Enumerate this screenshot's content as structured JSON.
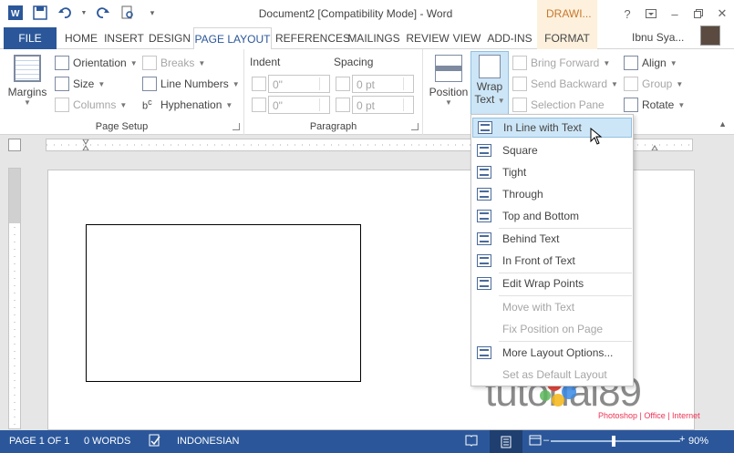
{
  "window": {
    "title": "Document2 [Compatibility Mode] - Word",
    "contextual_tab_group": "DRAWI..."
  },
  "tabs": [
    {
      "label": "FILE"
    },
    {
      "label": "HOME"
    },
    {
      "label": "INSERT"
    },
    {
      "label": "DESIGN"
    },
    {
      "label": "PAGE LAYOUT"
    },
    {
      "label": "REFERENCES"
    },
    {
      "label": "MAILINGS"
    },
    {
      "label": "REVIEW"
    },
    {
      "label": "VIEW"
    },
    {
      "label": "ADD-INS"
    },
    {
      "label": "FORMAT"
    }
  ],
  "user": {
    "name": "Ibnu Sya..."
  },
  "ribbon": {
    "page_setup": {
      "group_label": "Page Setup",
      "margins": "Margins",
      "orientation": "Orientation",
      "size": "Size",
      "columns": "Columns",
      "breaks": "Breaks",
      "line_numbers": "Line Numbers",
      "hyphenation": "Hyphenation"
    },
    "paragraph": {
      "group_label": "Paragraph",
      "indent_label": "Indent",
      "spacing_label": "Spacing",
      "indent_left": "0\"",
      "indent_right": "0\"",
      "spacing_before": "0 pt",
      "spacing_after": "0 pt"
    },
    "arrange": {
      "position": "Position",
      "wrap_text_line1": "Wrap",
      "wrap_text_line2": "Text",
      "bring_forward": "Bring Forward",
      "send_backward": "Send Backward",
      "selection_pane": "Selection Pane",
      "align": "Align",
      "group": "Group",
      "rotate": "Rotate"
    }
  },
  "wrap_menu": {
    "items": [
      {
        "label": "In Line with Text",
        "icon": "wrap-inline-icon",
        "enabled": true,
        "highlighted": true
      },
      {
        "label": "Square",
        "icon": "wrap-square-icon",
        "enabled": true
      },
      {
        "label": "Tight",
        "icon": "wrap-tight-icon",
        "enabled": true
      },
      {
        "label": "Through",
        "icon": "wrap-through-icon",
        "enabled": true
      },
      {
        "label": "Top and Bottom",
        "icon": "wrap-top-bottom-icon",
        "enabled": true
      },
      {
        "label": "Behind Text",
        "icon": "wrap-behind-icon",
        "enabled": true
      },
      {
        "label": "In Front of Text",
        "icon": "wrap-front-icon",
        "enabled": true
      },
      {
        "label": "Edit Wrap Points",
        "icon": "edit-wrap-points-icon",
        "enabled": true
      },
      {
        "label": "Move with Text",
        "enabled": false
      },
      {
        "label": "Fix Position on Page",
        "enabled": false
      },
      {
        "label": "More Layout Options...",
        "icon": "layout-options-icon",
        "enabled": true
      },
      {
        "label": "Set as Default Layout",
        "enabled": false
      }
    ]
  },
  "status": {
    "page": "PAGE 1 OF 1",
    "words": "0 WORDS",
    "language": "INDONESIAN",
    "zoom": "90%"
  },
  "watermark": {
    "text": "tutorial89",
    "tagline": "Photoshop | Office | Internet"
  },
  "colors": {
    "accent": "#2b579a",
    "contextual": "#c6782d"
  }
}
